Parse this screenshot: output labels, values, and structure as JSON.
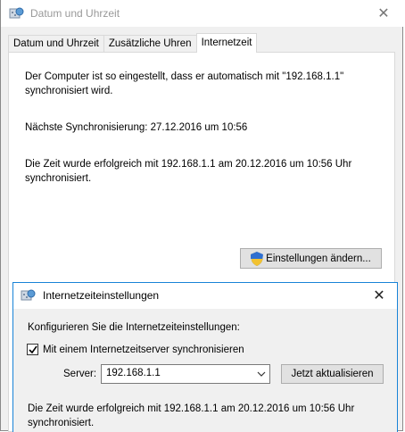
{
  "window": {
    "title": "Datum und Uhrzeit",
    "tabs": [
      {
        "label": "Datum und Uhrzeit"
      },
      {
        "label": "Zusätzliche Uhren"
      },
      {
        "label": "Internetzeit"
      }
    ],
    "active_tab": "Internetzeit",
    "info_line1": "Der Computer ist so eingestellt, dass er automatisch mit \"192.168.1.1\"",
    "info_line2": "synchronisiert wird.",
    "next_sync": "Nächste Synchronisierung: 27.12.2016 um 10:56",
    "result_line1": "Die Zeit wurde erfolgreich mit 192.168.1.1 am 20.12.2016 um 10:56 Uhr",
    "result_line2": "synchronisiert.",
    "change_settings_label": "Einstellungen ändern..."
  },
  "dialog": {
    "title": "Internetzeiteinstellungen",
    "prompt": "Konfigurieren Sie die Internetzeiteinstellungen:",
    "sync_checkbox_label": "Mit einem Internetzeitserver synchronisieren",
    "sync_checked": true,
    "server_label": "Server:",
    "server_value": "192.168.1.1",
    "update_button_label": "Jetzt aktualisieren",
    "result_line1": "Die Zeit wurde erfolgreich mit 192.168.1.1 am 20.12.2016 um 10:56 Uhr",
    "result_line2": "synchronisiert."
  },
  "colors": {
    "dialog_border": "#1883d7",
    "window_bg": "#f0f0f0",
    "title_inactive": "#999999"
  }
}
